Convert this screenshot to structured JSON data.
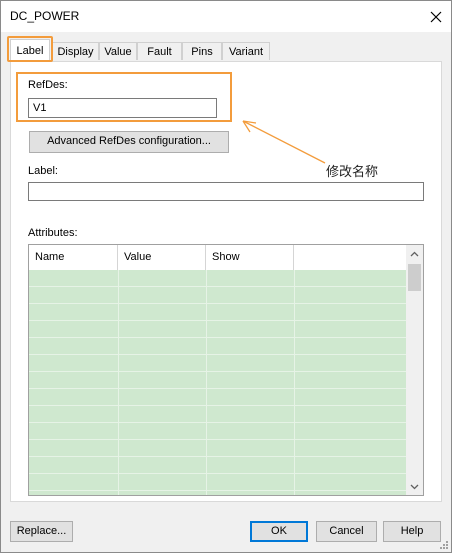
{
  "window": {
    "title": "DC_POWER"
  },
  "tabs": [
    {
      "label": "Label"
    },
    {
      "label": "Display"
    },
    {
      "label": "Value"
    },
    {
      "label": "Fault"
    },
    {
      "label": "Pins"
    },
    {
      "label": "Variant"
    }
  ],
  "refdes": {
    "label": "RefDes:",
    "value": "V1"
  },
  "advanced_button": "Advanced RefDes configuration...",
  "annotation": "修改名称",
  "label_field": {
    "label": "Label:",
    "value": ""
  },
  "attributes": {
    "label": "Attributes:",
    "columns": [
      "Name",
      "Value",
      "Show",
      ""
    ],
    "rows": []
  },
  "footer": {
    "replace": "Replace...",
    "ok": "OK",
    "cancel": "Cancel",
    "help": "Help"
  },
  "colors": {
    "highlight": "#f39c3c",
    "grid_fill": "#cfe8cf",
    "default_button_border": "#0078d7"
  },
  "icons": {
    "close": "close-icon",
    "scroll_up": "chevron-up-icon",
    "scroll_down": "chevron-down-icon",
    "resize": "resize-grip-icon"
  }
}
